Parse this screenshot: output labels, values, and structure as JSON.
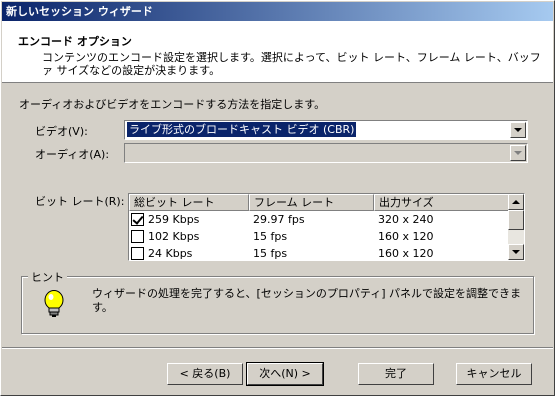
{
  "window": {
    "title": "新しいセッション ウィザード"
  },
  "header": {
    "title": "エンコード オプション",
    "description": "コンテンツのエンコード設定を選択します。選択によって、ビット レート、フレーム レート、バッファ サイズなどの設定が決まります。"
  },
  "instruction": "オーディオおよびビデオをエンコードする方法を指定します。",
  "video": {
    "label": "ビデオ(V):",
    "value": "ライブ形式のブロードキャスト ビデオ (CBR)"
  },
  "audio": {
    "label": "オーディオ(A):",
    "value": ""
  },
  "bitrate": {
    "label": "ビット レート(R):",
    "columns": [
      "総ビット レート",
      "フレーム レート",
      "出力サイズ"
    ],
    "rows": [
      {
        "checked": true,
        "bitrate": "259 Kbps",
        "framerate": "29.97 fps",
        "size": "320 x 240"
      },
      {
        "checked": false,
        "bitrate": "102 Kbps",
        "framerate": "15 fps",
        "size": "160 x 120"
      },
      {
        "checked": false,
        "bitrate": "24 Kbps",
        "framerate": "15 fps",
        "size": "160 x 120"
      }
    ]
  },
  "hint": {
    "label": "ヒント",
    "text": "ウィザードの処理を完了すると、[セッションのプロパティ] パネルで設定を調整できます。",
    "icon": "lightbulb-icon"
  },
  "buttons": {
    "back": "< 戻る(B)",
    "next": "次へ(N) >",
    "finish": "完了",
    "cancel": "キャンセル"
  },
  "colors": {
    "titlebar": "#0a246a",
    "face": "#d4d0c8",
    "selection": "#0a246a"
  }
}
